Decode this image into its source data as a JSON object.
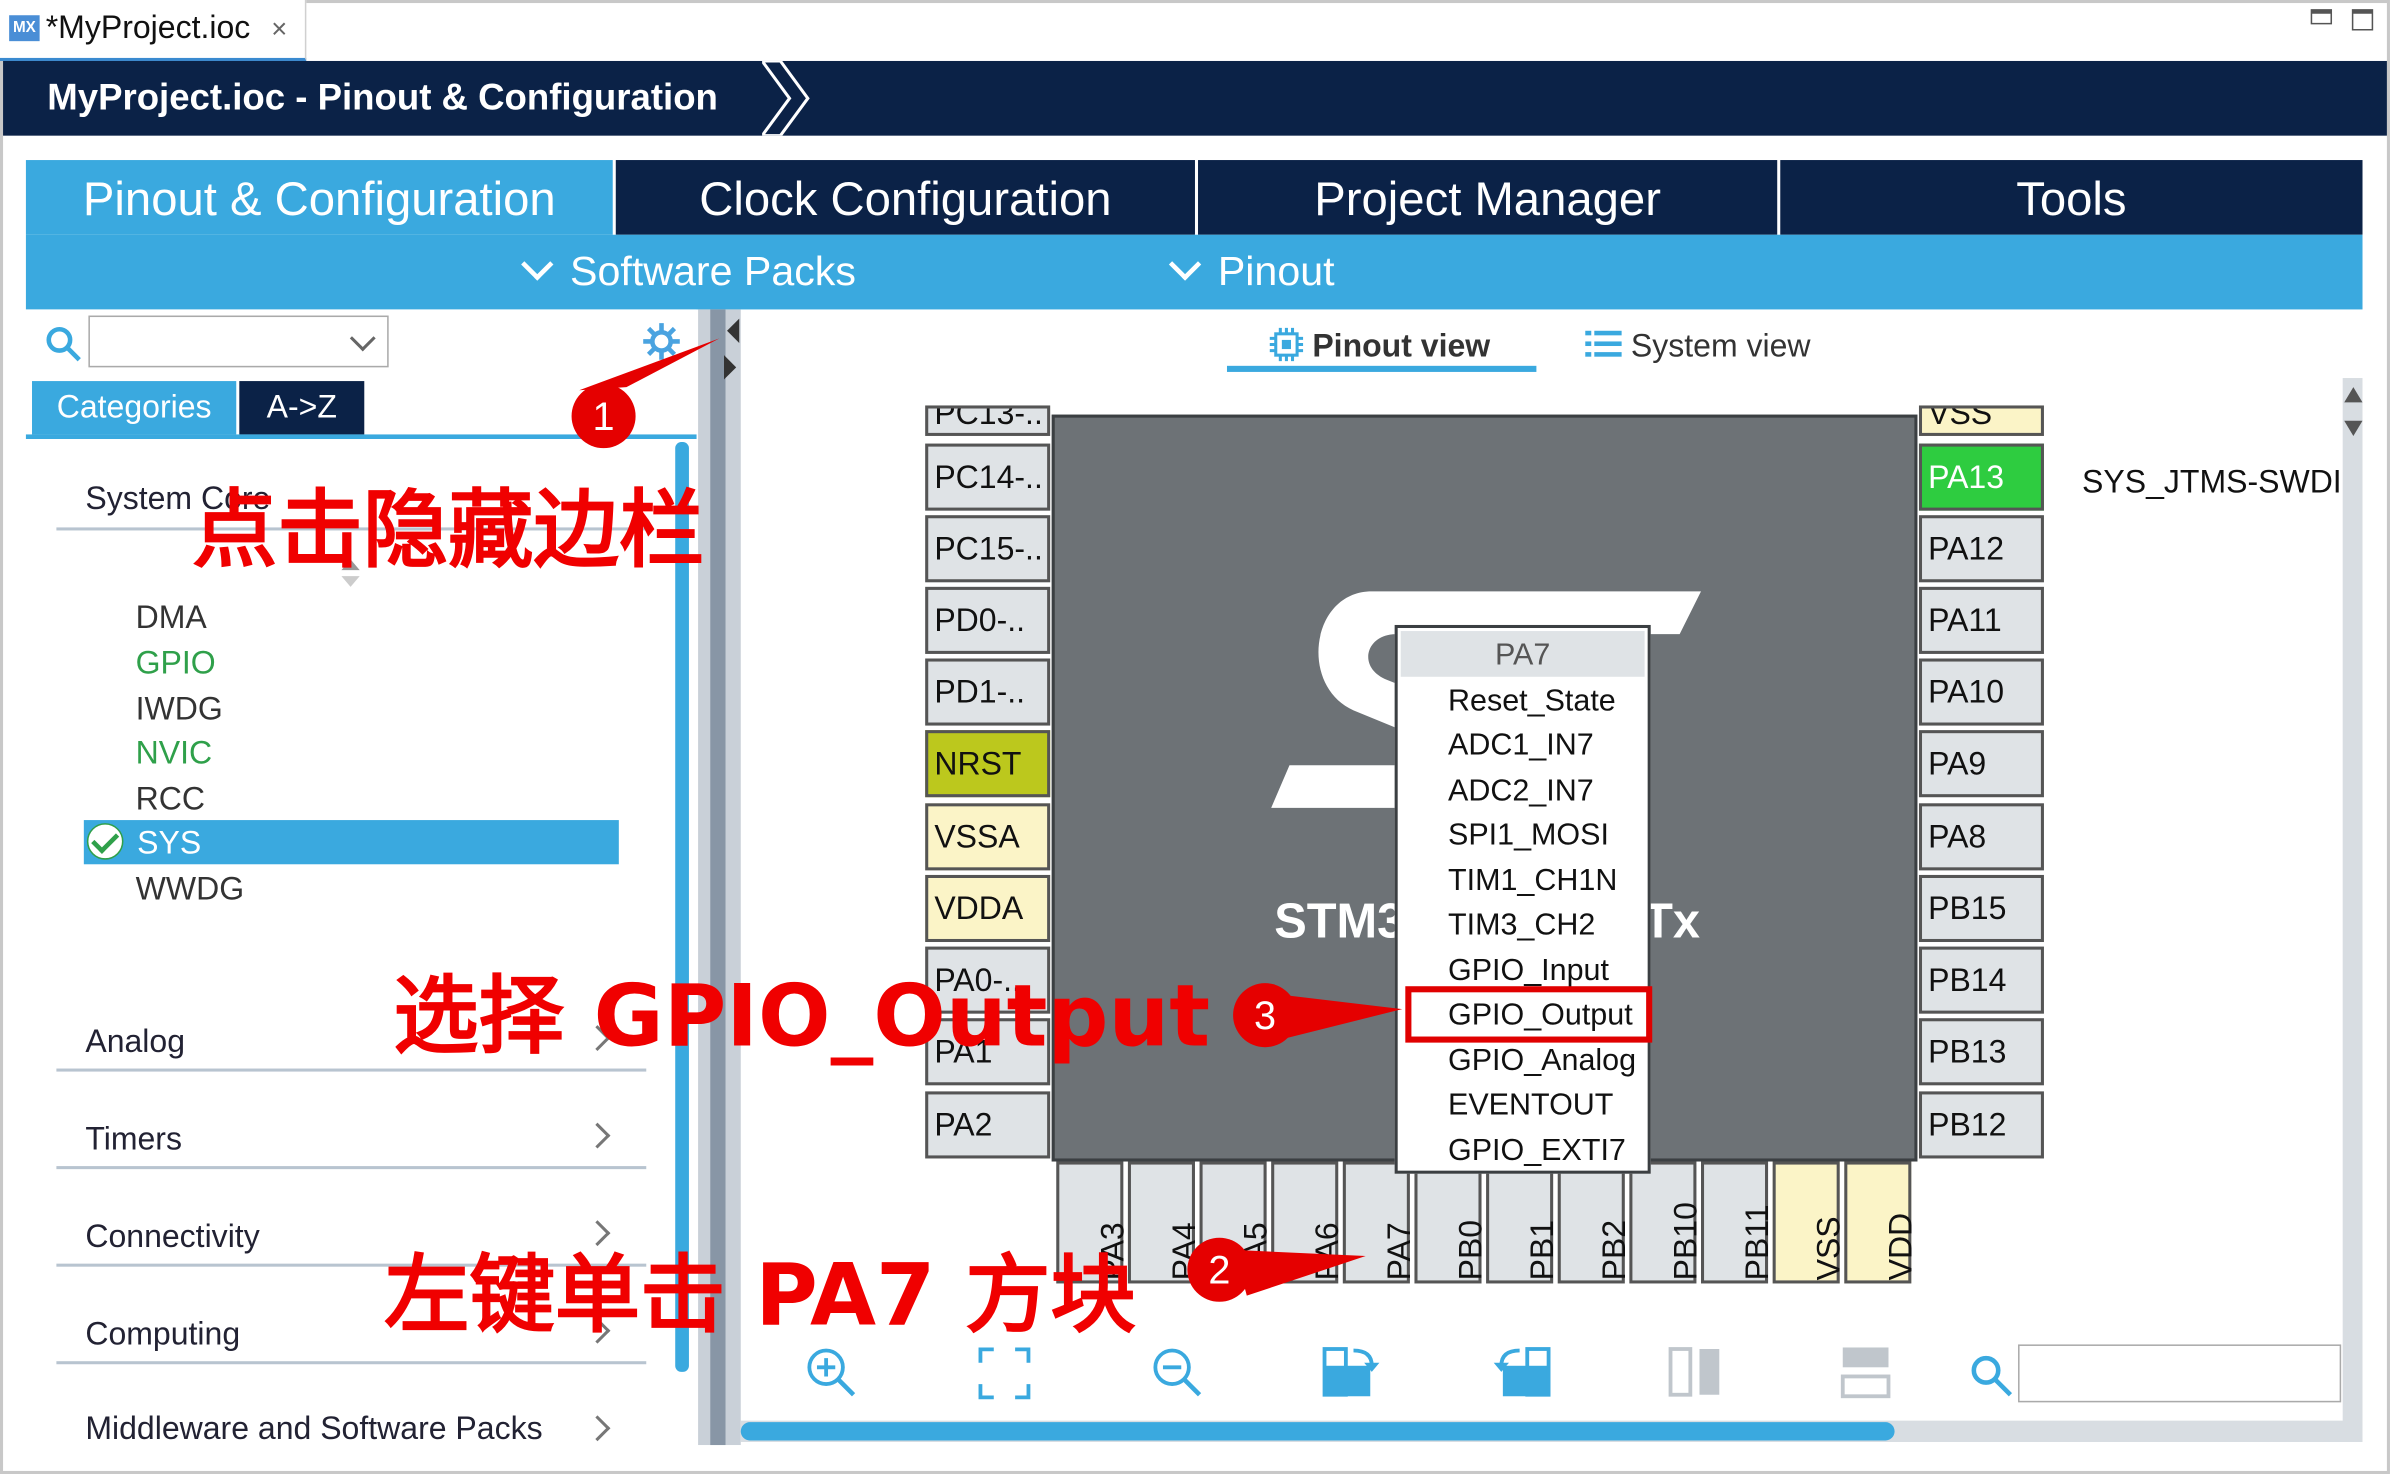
{
  "window": {
    "file_tab": "*MyProject.ioc",
    "mx_badge": "MX",
    "close_glyph": "×"
  },
  "breadcrumb": "MyProject.ioc - Pinout & Configuration",
  "main_tabs": [
    {
      "label": "Pinout & Configuration",
      "active": true
    },
    {
      "label": "Clock Configuration",
      "active": false
    },
    {
      "label": "Project Manager",
      "active": false
    },
    {
      "label": "Tools",
      "active": false
    }
  ],
  "sub_menus": [
    "Software Packs",
    "Pinout"
  ],
  "left_panel": {
    "search_placeholder": "",
    "tabs": [
      "Categories",
      "A->Z"
    ],
    "system_core_label": "System Core",
    "peripherals": [
      {
        "label": "DMA",
        "status": "default"
      },
      {
        "label": "GPIO",
        "status": "green"
      },
      {
        "label": "IWDG",
        "status": "default"
      },
      {
        "label": "NVIC",
        "status": "green"
      },
      {
        "label": "RCC",
        "status": "default"
      },
      {
        "label": "SYS",
        "status": "selected"
      },
      {
        "label": "WWDG",
        "status": "default"
      }
    ],
    "categories": [
      "Analog",
      "Timers",
      "Connectivity",
      "Computing",
      "Middleware and Software Packs"
    ]
  },
  "view_tabs": {
    "pinout_view": "Pinout view",
    "system_view": "System view"
  },
  "chip": {
    "name_left": "STM3",
    "name_right": "Tx"
  },
  "pins_left": [
    "PC13-..",
    "PC14-..",
    "PC15-..",
    "PD0-..",
    "PD1-..",
    "NRST",
    "VSSA",
    "VDDA",
    "PA0-..",
    "PA1",
    "PA2"
  ],
  "pins_right": [
    "VSS",
    "PA13",
    "PA12",
    "PA11",
    "PA10",
    "PA9",
    "PA8",
    "PB15",
    "PB14",
    "PB13",
    "PB12"
  ],
  "pins_bottom": [
    "PA3",
    "PA4",
    "PA5",
    "PA6",
    "PA7",
    "PB0",
    "PB1",
    "PB2",
    "PB10",
    "PB11",
    "VSS",
    "VDD"
  ],
  "pa13_function": "SYS_JTMS-SWDIO",
  "pin_menu": {
    "title": "PA7",
    "items": [
      "Reset_State",
      "ADC1_IN7",
      "ADC2_IN7",
      "SPI1_MOSI",
      "TIM1_CH1N",
      "TIM3_CH2",
      "GPIO_Input",
      "GPIO_Output",
      "GPIO_Analog",
      "EVENTOUT",
      "GPIO_EXTI7"
    ],
    "highlighted": "GPIO_Output"
  },
  "toolbar_icons": [
    "zoom-in-icon",
    "fit-screen-icon",
    "zoom-out-icon",
    "rotate-right-icon",
    "rotate-left-icon",
    "flip-vertical-icon",
    "flip-horizontal-icon",
    "search-icon"
  ],
  "annotations": {
    "step1_number": "1",
    "step1_text": "点击隐藏边栏",
    "step2_number": "2",
    "step2_text": "左键单击 PA7 方块",
    "step3_number": "3",
    "step3_text": "选择 GPIO_Output"
  },
  "colors": {
    "navy": "#0b2247",
    "accent": "#3aa9df",
    "annotation": "#f00000",
    "pin_assigned": "#2ecc40",
    "pin_nrst": "#bcc81d",
    "pin_power": "#fbf4c7"
  }
}
